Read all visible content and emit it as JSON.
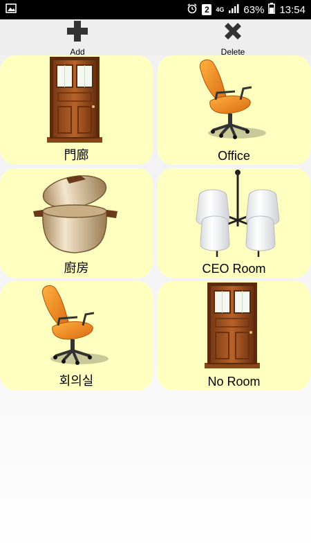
{
  "status_bar": {
    "icons": [
      "image-icon",
      "alarm-icon",
      "sim-2-icon",
      "4g-icon",
      "signal-icon",
      "battery-icon"
    ],
    "sim_label": "2",
    "network_label": "4G",
    "battery": "63%",
    "time": "13:54"
  },
  "toolbar": {
    "add_label": "Add",
    "delete_label": "Delete"
  },
  "rooms": [
    {
      "label": "門廊",
      "icon": "door-icon"
    },
    {
      "label": "Office",
      "icon": "office-chair-icon"
    },
    {
      "label": "廚房",
      "icon": "cooking-pot-icon"
    },
    {
      "label": "CEO Room",
      "icon": "chandelier-icon"
    },
    {
      "label": "회의실",
      "icon": "office-chair-icon"
    },
    {
      "label": "No Room",
      "icon": "door-icon"
    }
  ],
  "colors": {
    "tile_background": "#ffffc0",
    "status_bar": "#000000",
    "toolbar": "#eeeeee"
  }
}
